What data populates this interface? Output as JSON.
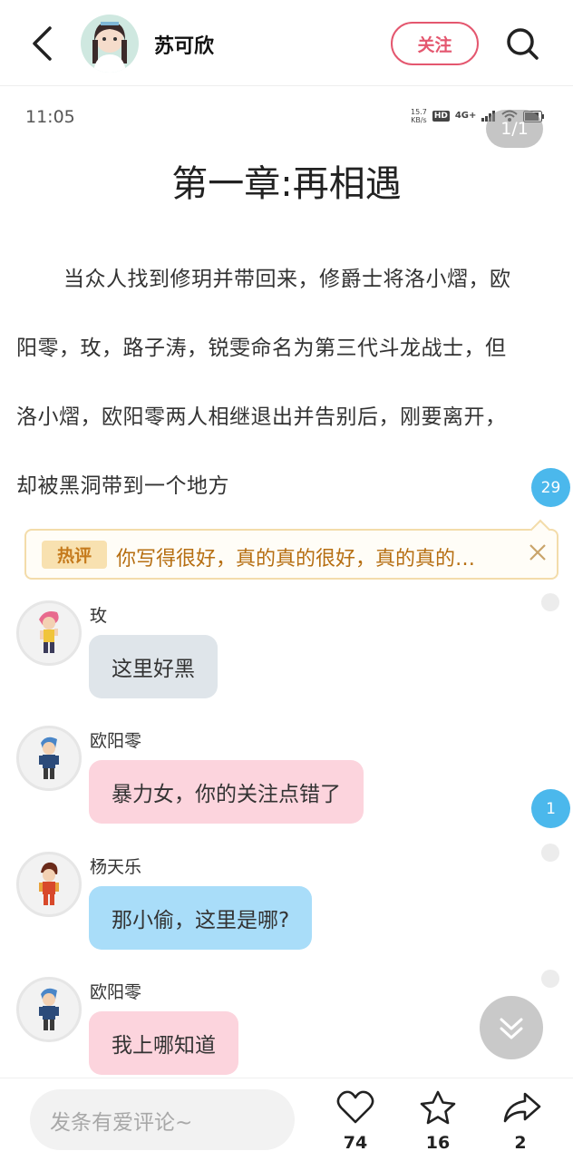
{
  "header": {
    "back_icon": "chevron-left-icon",
    "author_name": "苏可欣",
    "follow_label": "关注",
    "search_icon": "search-icon"
  },
  "status_bar": {
    "time": "11:05",
    "speed_value": "15.7",
    "speed_unit": "KB/s",
    "hd": "HD",
    "network": "4G+"
  },
  "page_indicator": "1/1",
  "chapter_title": "第一章:再相遇",
  "paragraph": "当众人找到修玥并带回来，修爵士将洛小熠，欧阳零，玫，路子涛，锐雯命名为第三代斗龙战士，但洛小熠，欧阳零两人相继退出并告别后，刚要离开，却被黑洞带到一个地方",
  "paragraph_comment_count": "29",
  "hot_comment": {
    "tag": "热评",
    "text": "你写得很好，真的真的很好，真的真的…"
  },
  "messages": [
    {
      "name": "玫",
      "text": "这里好黑"
    },
    {
      "name": "欧阳零",
      "text": "暴力女，你的关注点错了"
    },
    {
      "name": "杨天乐",
      "text": "那小偷，这里是哪?"
    },
    {
      "name": "欧阳零",
      "text": "我上哪知道"
    }
  ],
  "message_comment_count": "1",
  "bottom_bar": {
    "comment_placeholder": "发条有爱评论~",
    "likes": "74",
    "favorites": "16",
    "shares": "2"
  },
  "colors": {
    "accent": "#e4576f",
    "count_bubble": "#4bb8ec",
    "hot_text": "#b66e11"
  }
}
